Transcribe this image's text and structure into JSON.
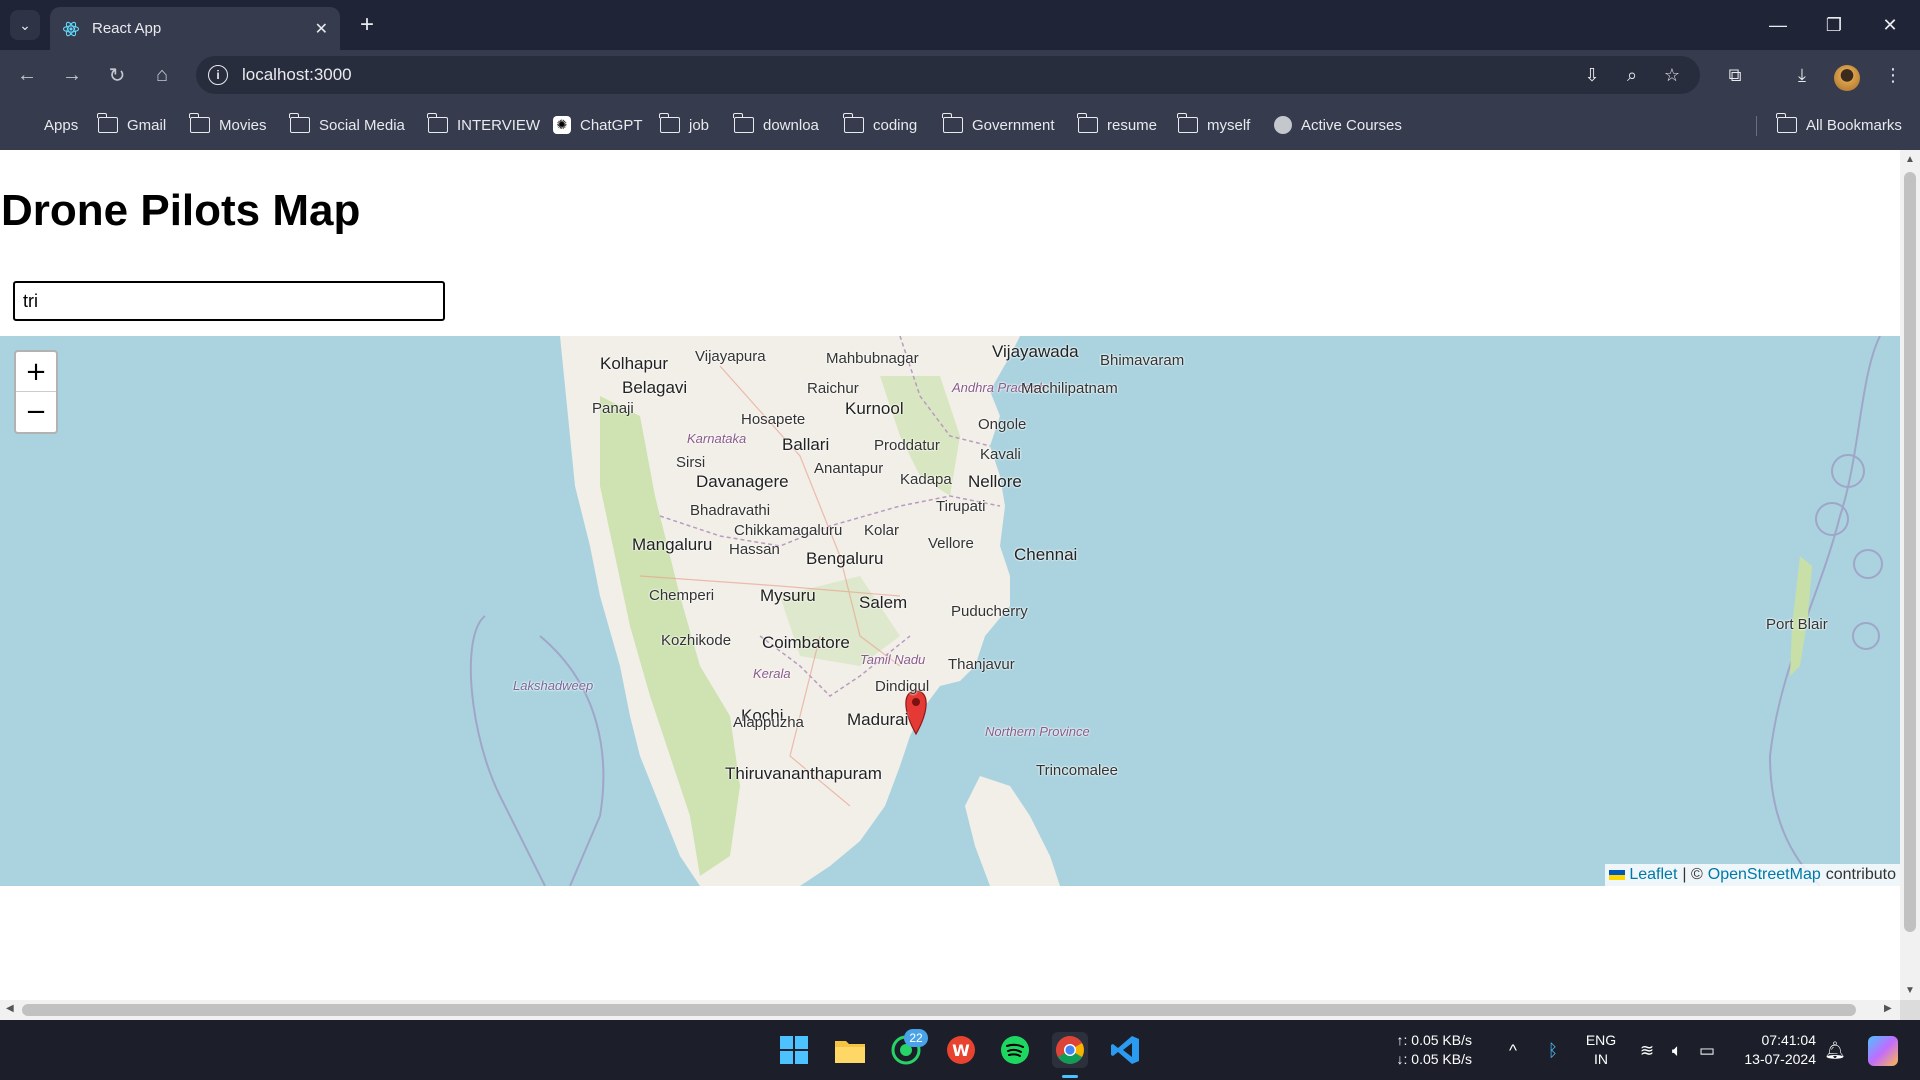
{
  "browser": {
    "tab_title": "React App",
    "url": "localhost:3000",
    "bookmarks": [
      {
        "label": "Apps",
        "icon": "apps-grid-icon"
      },
      {
        "label": "Gmail",
        "icon": "folder-icon"
      },
      {
        "label": "Movies",
        "icon": "folder-icon"
      },
      {
        "label": "Social Media",
        "icon": "folder-icon"
      },
      {
        "label": "INTERVIEW",
        "icon": "folder-icon"
      },
      {
        "label": "ChatGPT",
        "icon": "chatgpt-icon"
      },
      {
        "label": "job",
        "icon": "folder-icon"
      },
      {
        "label": "downloa",
        "icon": "folder-icon"
      },
      {
        "label": "coding",
        "icon": "folder-icon"
      },
      {
        "label": "Government",
        "icon": "folder-icon"
      },
      {
        "label": "resume",
        "icon": "folder-icon"
      },
      {
        "label": "myself",
        "icon": "folder-icon"
      },
      {
        "label": "Active Courses",
        "icon": "globe-icon"
      }
    ],
    "all_bookmarks": "All Bookmarks"
  },
  "page": {
    "title": "Drone Pilots Map",
    "search_value": "tri"
  },
  "map": {
    "zoom_in": "+",
    "zoom_out": "−",
    "labels": [
      {
        "text": "Kolhapur",
        "kind": "big"
      },
      {
        "text": "Vijayapura",
        "kind": "normal"
      },
      {
        "text": "Mahbubnagar",
        "kind": "normal"
      },
      {
        "text": "Vijayawada",
        "kind": "big"
      },
      {
        "text": "Bhimavaram",
        "kind": "normal"
      },
      {
        "text": "Belagavi",
        "kind": "big"
      },
      {
        "text": "Raichur",
        "kind": "normal"
      },
      {
        "text": "Andhra Pradesh",
        "kind": "region"
      },
      {
        "text": "Machilipatnam",
        "kind": "normal"
      },
      {
        "text": "Panaji",
        "kind": "normal"
      },
      {
        "text": "Kurnool",
        "kind": "big"
      },
      {
        "text": "Hosapete",
        "kind": "normal"
      },
      {
        "text": "Ongole",
        "kind": "normal"
      },
      {
        "text": "Karnataka",
        "kind": "region"
      },
      {
        "text": "Ballari",
        "kind": "big"
      },
      {
        "text": "Proddatur",
        "kind": "normal"
      },
      {
        "text": "Sirsi",
        "kind": "normal"
      },
      {
        "text": "Kavali",
        "kind": "normal"
      },
      {
        "text": "Anantapur",
        "kind": "normal"
      },
      {
        "text": "Davanagere",
        "kind": "big"
      },
      {
        "text": "Kadapa",
        "kind": "normal"
      },
      {
        "text": "Nellore",
        "kind": "big"
      },
      {
        "text": "Bhadravathi",
        "kind": "normal"
      },
      {
        "text": "Tirupati",
        "kind": "normal"
      },
      {
        "text": "Chikkamagaluru",
        "kind": "normal"
      },
      {
        "text": "Kolar",
        "kind": "normal"
      },
      {
        "text": "Mangaluru",
        "kind": "big"
      },
      {
        "text": "Hassan",
        "kind": "normal"
      },
      {
        "text": "Vellore",
        "kind": "normal"
      },
      {
        "text": "Bengaluru",
        "kind": "big"
      },
      {
        "text": "Chennai",
        "kind": "big"
      },
      {
        "text": "Chemperi",
        "kind": "normal"
      },
      {
        "text": "Mysuru",
        "kind": "big"
      },
      {
        "text": "Salem",
        "kind": "big"
      },
      {
        "text": "Puducherry",
        "kind": "normal"
      },
      {
        "text": "Kozhikode",
        "kind": "normal"
      },
      {
        "text": "Coimbatore",
        "kind": "big"
      },
      {
        "text": "Thanjavur",
        "kind": "normal"
      },
      {
        "text": "Tamil Nadu",
        "kind": "region"
      },
      {
        "text": "Kerala",
        "kind": "region"
      },
      {
        "text": "Dindigul",
        "kind": "normal"
      },
      {
        "text": "Lakshadweep",
        "kind": "sea"
      },
      {
        "text": "Kochi",
        "kind": "big"
      },
      {
        "text": "Alappuzha",
        "kind": "normal"
      },
      {
        "text": "Madurai",
        "kind": "big"
      },
      {
        "text": "Northern Province",
        "kind": "region"
      },
      {
        "text": "Trincomalee",
        "kind": "normal"
      },
      {
        "text": "Thiruvananthapuram",
        "kind": "big"
      },
      {
        "text": "Port Blair",
        "kind": "normal"
      }
    ],
    "attribution": {
      "leaflet": "Leaflet",
      "separator": "| ©",
      "osm": "OpenStreetMap",
      "suffix": "contributo"
    }
  },
  "taskbar": {
    "whatsapp_badge": "22",
    "net_up": "↑: 0.05 KB/s",
    "net_down": "↓: 0.05 KB/s",
    "lang_1": "ENG",
    "lang_2": "IN",
    "time": "07:41:04",
    "date": "13-07-2024"
  },
  "colors": {
    "sea": "#aad3df",
    "land": "#f2efe9",
    "green": "#c8dfa8",
    "marker": "#e53935",
    "link": "#0078a8"
  }
}
